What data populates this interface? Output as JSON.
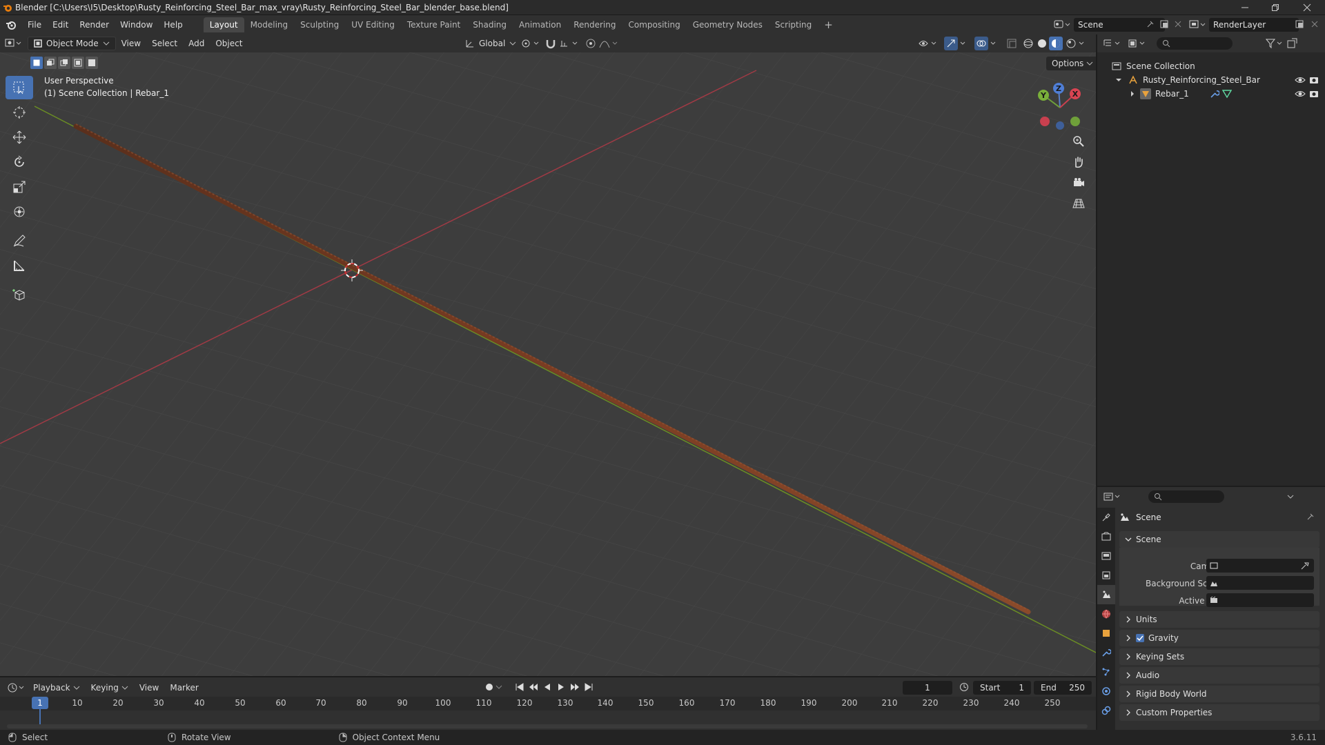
{
  "window": {
    "title": "Blender [C:\\Users\\I5\\Desktop\\Rusty_Reinforcing_Steel_Bar_max_vray\\Rusty_Reinforcing_Steel_Bar_blender_base.blend]"
  },
  "menu": [
    "File",
    "Edit",
    "Render",
    "Window",
    "Help"
  ],
  "workspaces": [
    "Layout",
    "Modeling",
    "Sculpting",
    "UV Editing",
    "Texture Paint",
    "Shading",
    "Animation",
    "Rendering",
    "Compositing",
    "Geometry Nodes",
    "Scripting"
  ],
  "scene_name": "Scene",
  "view_layer": "RenderLayer",
  "viewport_header": {
    "mode": "Object Mode",
    "menus": [
      "View",
      "Select",
      "Add",
      "Object"
    ],
    "orientation": "Global",
    "options": "Options"
  },
  "viewport": {
    "perspective": "User Perspective",
    "collection_info": "(1) Scene Collection | Rebar_1",
    "gizmo_axes": [
      "Z",
      "Y",
      "X"
    ]
  },
  "outliner": {
    "root": "Scene Collection",
    "collection": "Rusty_Reinforcing_Steel_Bar",
    "object": "Rebar_1"
  },
  "properties": {
    "context": "Scene",
    "panel_scene": "Scene",
    "fields": [
      {
        "label": "Camera"
      },
      {
        "label": "Background Scene"
      },
      {
        "label": "Active Clip"
      }
    ],
    "panels": [
      "Units",
      "Gravity",
      "Keying Sets",
      "Audio",
      "Rigid Body World",
      "Custom Properties"
    ]
  },
  "timeline": {
    "menus": [
      "Playback",
      "Keying",
      "View",
      "Marker"
    ],
    "current_frame": "1",
    "start_label": "Start",
    "start": "1",
    "end_label": "End",
    "end": "250",
    "ticks": [
      "1",
      "10",
      "20",
      "30",
      "40",
      "50",
      "60",
      "70",
      "80",
      "90",
      "100",
      "110",
      "120",
      "130",
      "140",
      "150",
      "160",
      "170",
      "180",
      "190",
      "200",
      "210",
      "220",
      "230",
      "240",
      "250"
    ]
  },
  "statusbar": {
    "select": "Select",
    "rotate": "Rotate View",
    "context_menu": "Object Context Menu",
    "version": "3.6.11"
  }
}
